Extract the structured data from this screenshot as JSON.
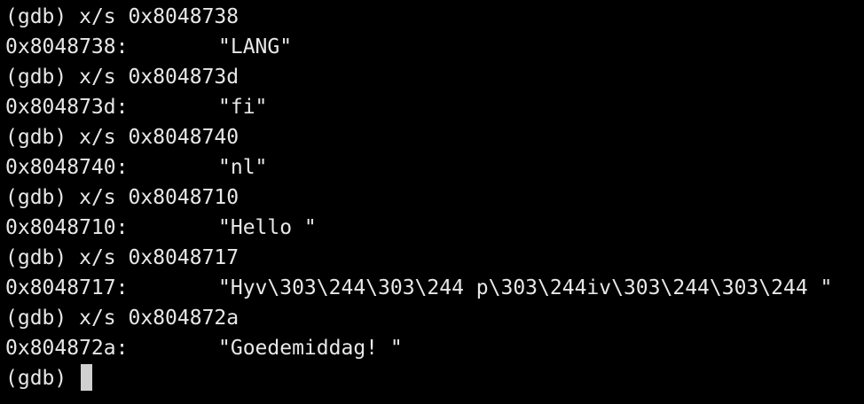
{
  "colors": {
    "background": "#000000",
    "text": "#e8e8e8",
    "cursor": "#d0d0d0"
  },
  "session": {
    "prompt": "(gdb)",
    "entries": [
      {
        "command": "x/s 0x8048738",
        "address": "0x8048738:",
        "value": "\"LANG\""
      },
      {
        "command": "x/s 0x804873d",
        "address": "0x804873d:",
        "value": "\"fi\""
      },
      {
        "command": "x/s 0x8048740",
        "address": "0x8048740:",
        "value": "\"nl\""
      },
      {
        "command": "x/s 0x8048710",
        "address": "0x8048710:",
        "value": "\"Hello \""
      },
      {
        "command": "x/s 0x8048717",
        "address": "0x8048717:",
        "value": "\"Hyv\\303\\244\\303\\244 p\\303\\244iv\\303\\244\\303\\244 \""
      },
      {
        "command": "x/s 0x804872a",
        "address": "0x804872a:",
        "value": "\"Goedemiddag! \""
      }
    ]
  }
}
